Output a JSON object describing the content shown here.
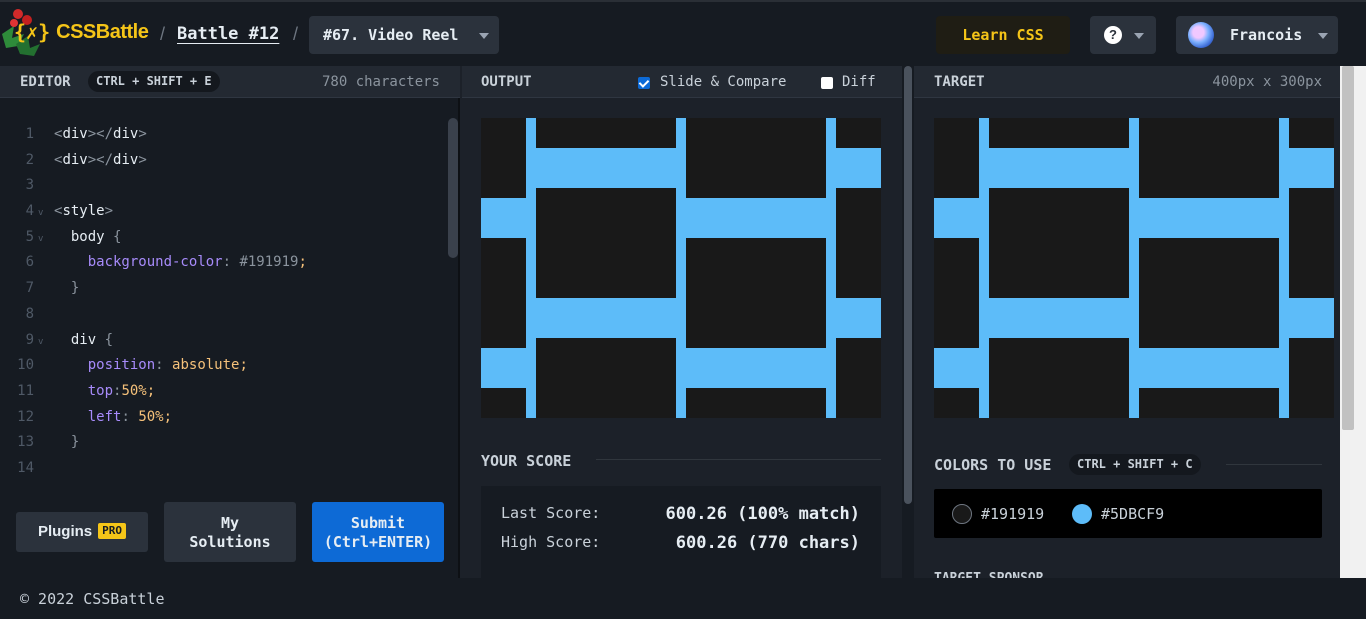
{
  "header": {
    "logo_mark": "{✗}",
    "logo_text": "CSSBattle",
    "separator": "/",
    "battle_label": "Battle #12",
    "challenge_select": "#67. Video Reel",
    "learn_label": "Learn CSS",
    "help_label": "?",
    "user_name": "Francois"
  },
  "editor": {
    "title": "EDITOR",
    "shortcut": "CTRL + SHIFT + E",
    "char_count": "780 characters",
    "lines": [
      {
        "n": "1",
        "html": "<span class='t-punc'>&lt;</span><span class='t-tag'>div</span><span class='t-punc'>&gt;&lt;/</span><span class='t-tag'>div</span><span class='t-punc'>&gt;</span>"
      },
      {
        "n": "2",
        "html": "<span class='t-punc'>&lt;</span><span class='t-tag'>div</span><span class='t-punc'>&gt;&lt;/</span><span class='t-tag'>div</span><span class='t-punc'>&gt;</span>"
      },
      {
        "n": "3",
        "html": ""
      },
      {
        "n": "4",
        "fold": true,
        "html": "<span class='t-punc'>&lt;</span><span class='t-tag'>style</span><span class='t-punc'>&gt;</span>"
      },
      {
        "n": "5",
        "fold": true,
        "html": "  <span class='t-tag'>body</span> <span class='t-punc'>{</span>"
      },
      {
        "n": "6",
        "html": "    <span class='t-prop'>background-color</span><span class='t-punc'>:</span> <span class='t-hex'>#191919</span><span class='t-semi'>;</span>"
      },
      {
        "n": "7",
        "html": "  <span class='t-punc'>}</span>"
      },
      {
        "n": "8",
        "html": ""
      },
      {
        "n": "9",
        "fold": true,
        "html": "  <span class='t-tag'>div</span> <span class='t-punc'>{</span>"
      },
      {
        "n": "10",
        "html": "    <span class='t-prop'>position</span><span class='t-punc'>:</span> <span class='t-val'>absolute</span><span class='t-semi'>;</span>"
      },
      {
        "n": "11",
        "html": "    <span class='t-prop'>top</span><span class='t-punc'>:</span><span class='t-num'>50%</span><span class='t-semi'>;</span>"
      },
      {
        "n": "12",
        "html": "    <span class='t-prop'>left</span><span class='t-punc'>:</span> <span class='t-num'>50%</span><span class='t-semi'>;</span>"
      },
      {
        "n": "13",
        "html": "  <span class='t-punc'>}</span>"
      },
      {
        "n": "14",
        "html": ""
      }
    ],
    "plugins_label": "Plugins",
    "pro_badge": "PRO",
    "solutions_line1": "My",
    "solutions_line2": "Solutions",
    "submit_line1": "Submit",
    "submit_line2": "(Ctrl+ENTER)"
  },
  "output": {
    "title": "OUTPUT",
    "slide_compare_label": "Slide & Compare",
    "slide_compare_checked": true,
    "diff_label": "Diff",
    "diff_checked": false,
    "score_title": "YOUR SCORE",
    "last_score_label": "Last Score:",
    "last_score_value": "600.26 (100% match)",
    "high_score_label": "High Score:",
    "high_score_value": "600.26 (770 chars)"
  },
  "target": {
    "title": "TARGET",
    "size_label": "400px x 300px",
    "colors_title": "COLORS TO USE",
    "colors_shortcut": "CTRL + SHIFT + C",
    "colors": [
      {
        "hex": "#191919",
        "label": "#191919"
      },
      {
        "hex": "#5DBCF9",
        "label": "#5DBCF9"
      }
    ],
    "sponsor_title": "TARGET SPONSOR"
  },
  "footer": {
    "copyright": "© 2022 CSSBattle"
  },
  "theme": {
    "accent": "#f5c518",
    "submit_blue": "#0d6ad6",
    "bg": "#191919",
    "fg": "#5DBCF9"
  }
}
